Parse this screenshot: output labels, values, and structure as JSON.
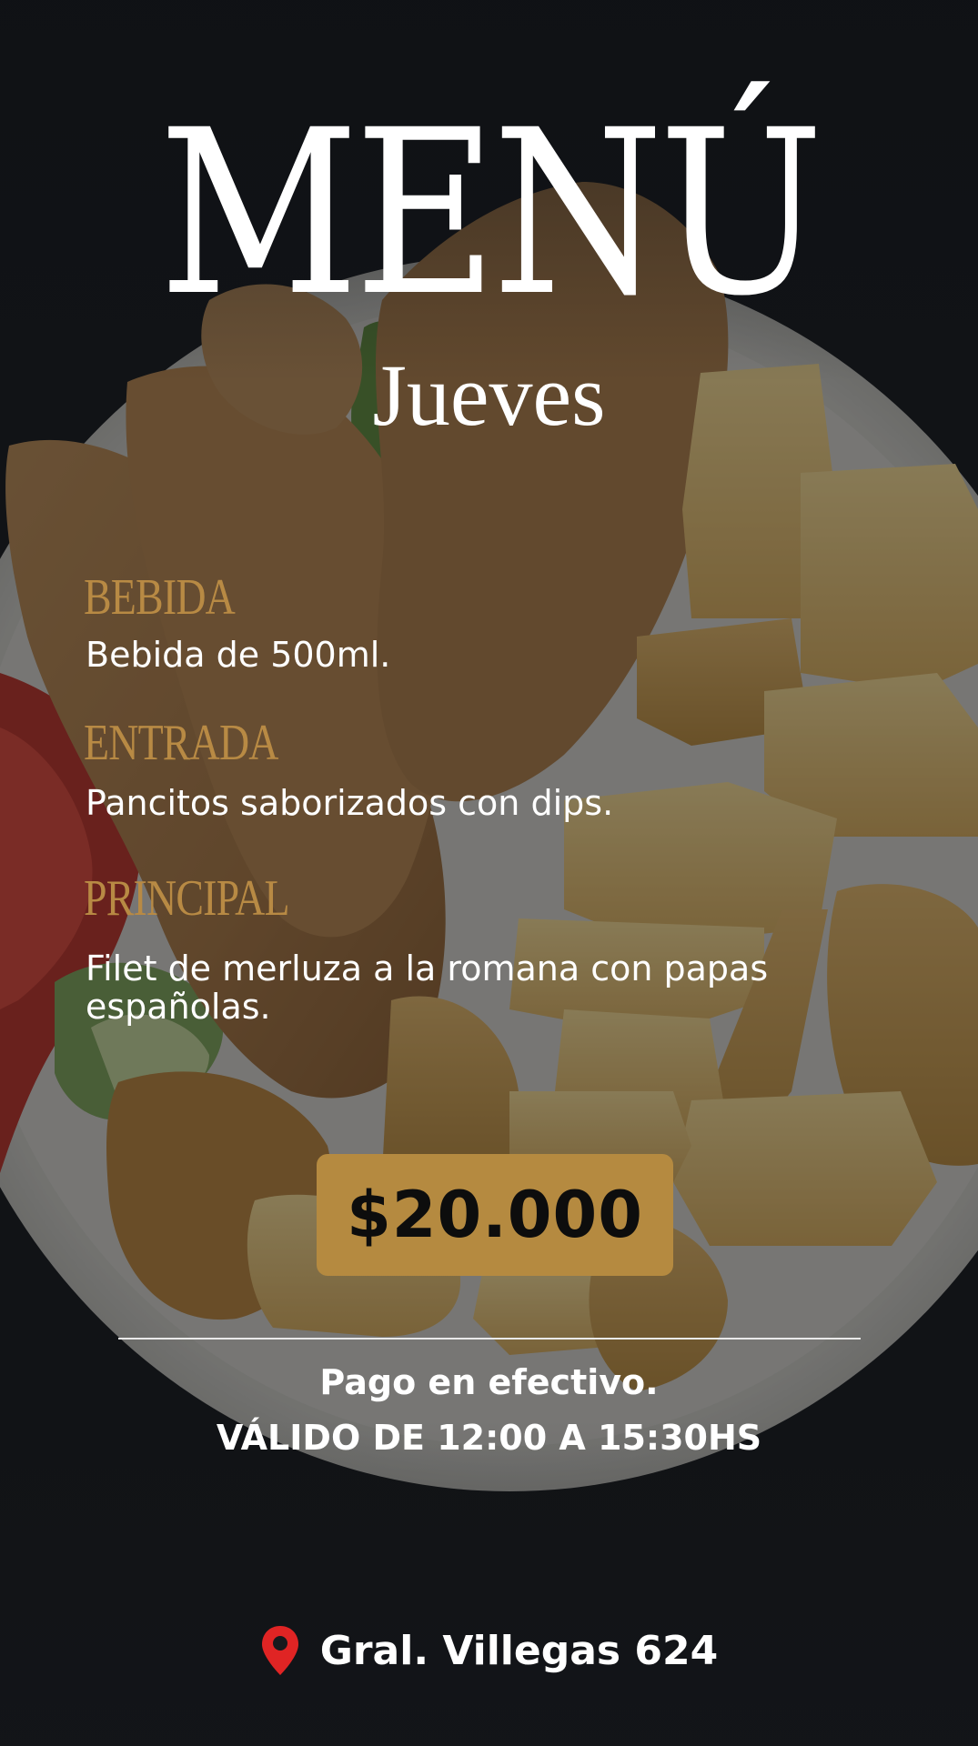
{
  "header": {
    "title": "MENÚ",
    "subtitle": "Jueves"
  },
  "menu": {
    "sections": [
      {
        "heading": "BEBIDA",
        "text": "Bebida de 500ml."
      },
      {
        "heading": "ENTRADA",
        "text": "Pancitos saborizados con dips."
      },
      {
        "heading": "PRINCIPAL",
        "text": "Filet de merluza a la romana con papas españolas."
      }
    ]
  },
  "price": {
    "label": "$20.000",
    "box_color": "#b58a40"
  },
  "footer": {
    "payment": "Pago en efectivo.",
    "validity": "VÁLIDO DE 12:00 A 15:30HS"
  },
  "address": {
    "icon": "map-pin-icon",
    "text": "Gral. Villegas 624",
    "icon_color": "#e02424"
  },
  "colors": {
    "background": "#17191d",
    "accent": "#b88a44",
    "text": "#ffffff"
  }
}
